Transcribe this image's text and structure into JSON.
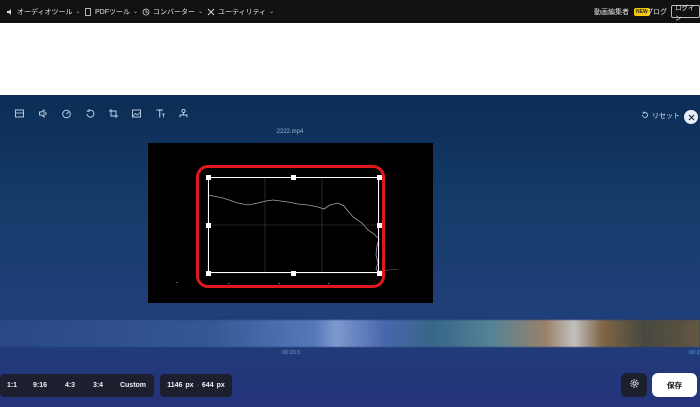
{
  "nav": {
    "items": [
      {
        "label": "オーディオツール",
        "icon": "audio-icon"
      },
      {
        "label": "PDFツール",
        "icon": "pdf-icon"
      },
      {
        "label": "コンバーター",
        "icon": "converter-icon"
      },
      {
        "label": "ユーティリティ",
        "icon": "utility-icon"
      }
    ],
    "video_editor": "動画編集者",
    "badge": "NEW",
    "blog": "ブログ",
    "login": "ログイン"
  },
  "editor": {
    "reset_label": "リセット",
    "filename": "2222.mp4",
    "timeline": {
      "time_center": "00:20.5",
      "time_right": "00:2"
    },
    "ratios": [
      "1:1",
      "9:16",
      "4:3",
      "3:4",
      "Custom"
    ],
    "size": {
      "width": "1146",
      "unit1": "px",
      "sep": "·",
      "height": "644",
      "unit2": "px"
    },
    "save_label": "保存"
  },
  "colors": {
    "highlight": "#e0171d",
    "badge": "#f5c800",
    "editor_bg": "#163b6a"
  }
}
